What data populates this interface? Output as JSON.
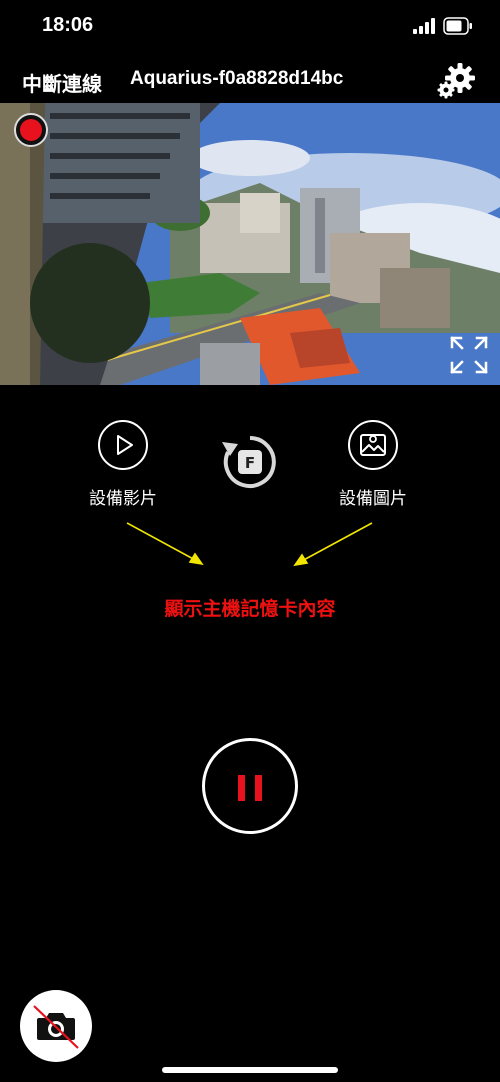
{
  "status_bar": {
    "time": "18:06",
    "signal_icon": "cellular-signal-icon",
    "battery_icon": "battery-icon"
  },
  "top_bar": {
    "disconnect_label": "中斷連線",
    "device_name": "Aquarius-f0a8828d14bc",
    "settings_icon": "gear-icon"
  },
  "live_view": {
    "recording_indicator": "recording-dot-icon",
    "fullscreen_icon": "fullscreen-icon"
  },
  "actions": {
    "video_label": "設備影片",
    "photo_label": "設備圖片",
    "video_icon": "play-icon",
    "photo_icon": "image-icon",
    "rotate_icon": "rotate-f-icon",
    "rotate_badge": "F"
  },
  "annotation": "顯示主機記憶卡內容",
  "controls": {
    "pause_icon": "pause-icon",
    "camera_icon": "camera-disabled-icon"
  },
  "colors": {
    "background": "#000000",
    "accent_red": "#e8121e",
    "annotation_red": "#ee1111",
    "arrow_yellow": "#f2e600"
  }
}
